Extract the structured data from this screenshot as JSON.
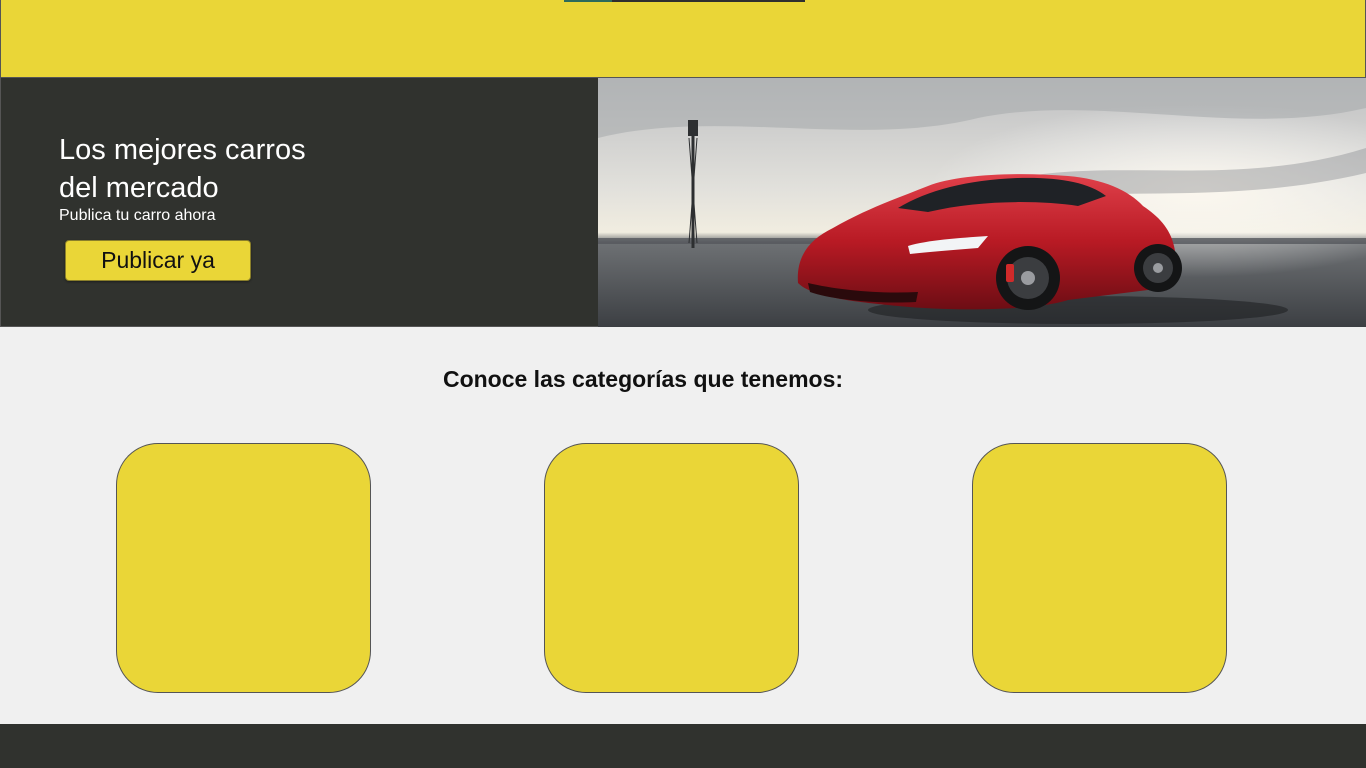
{
  "hero": {
    "title_line1": "Los mejores carros",
    "title_line2": "del mercado",
    "subtitle": "Publica tu carro ahora",
    "button_label": "Publicar ya"
  },
  "categories": {
    "title": "Conoce las categorías que tenemos:"
  },
  "colors": {
    "accent": "#ead637",
    "dark": "#30322e",
    "background": "#f0f0f0",
    "car": "#c8212b"
  }
}
